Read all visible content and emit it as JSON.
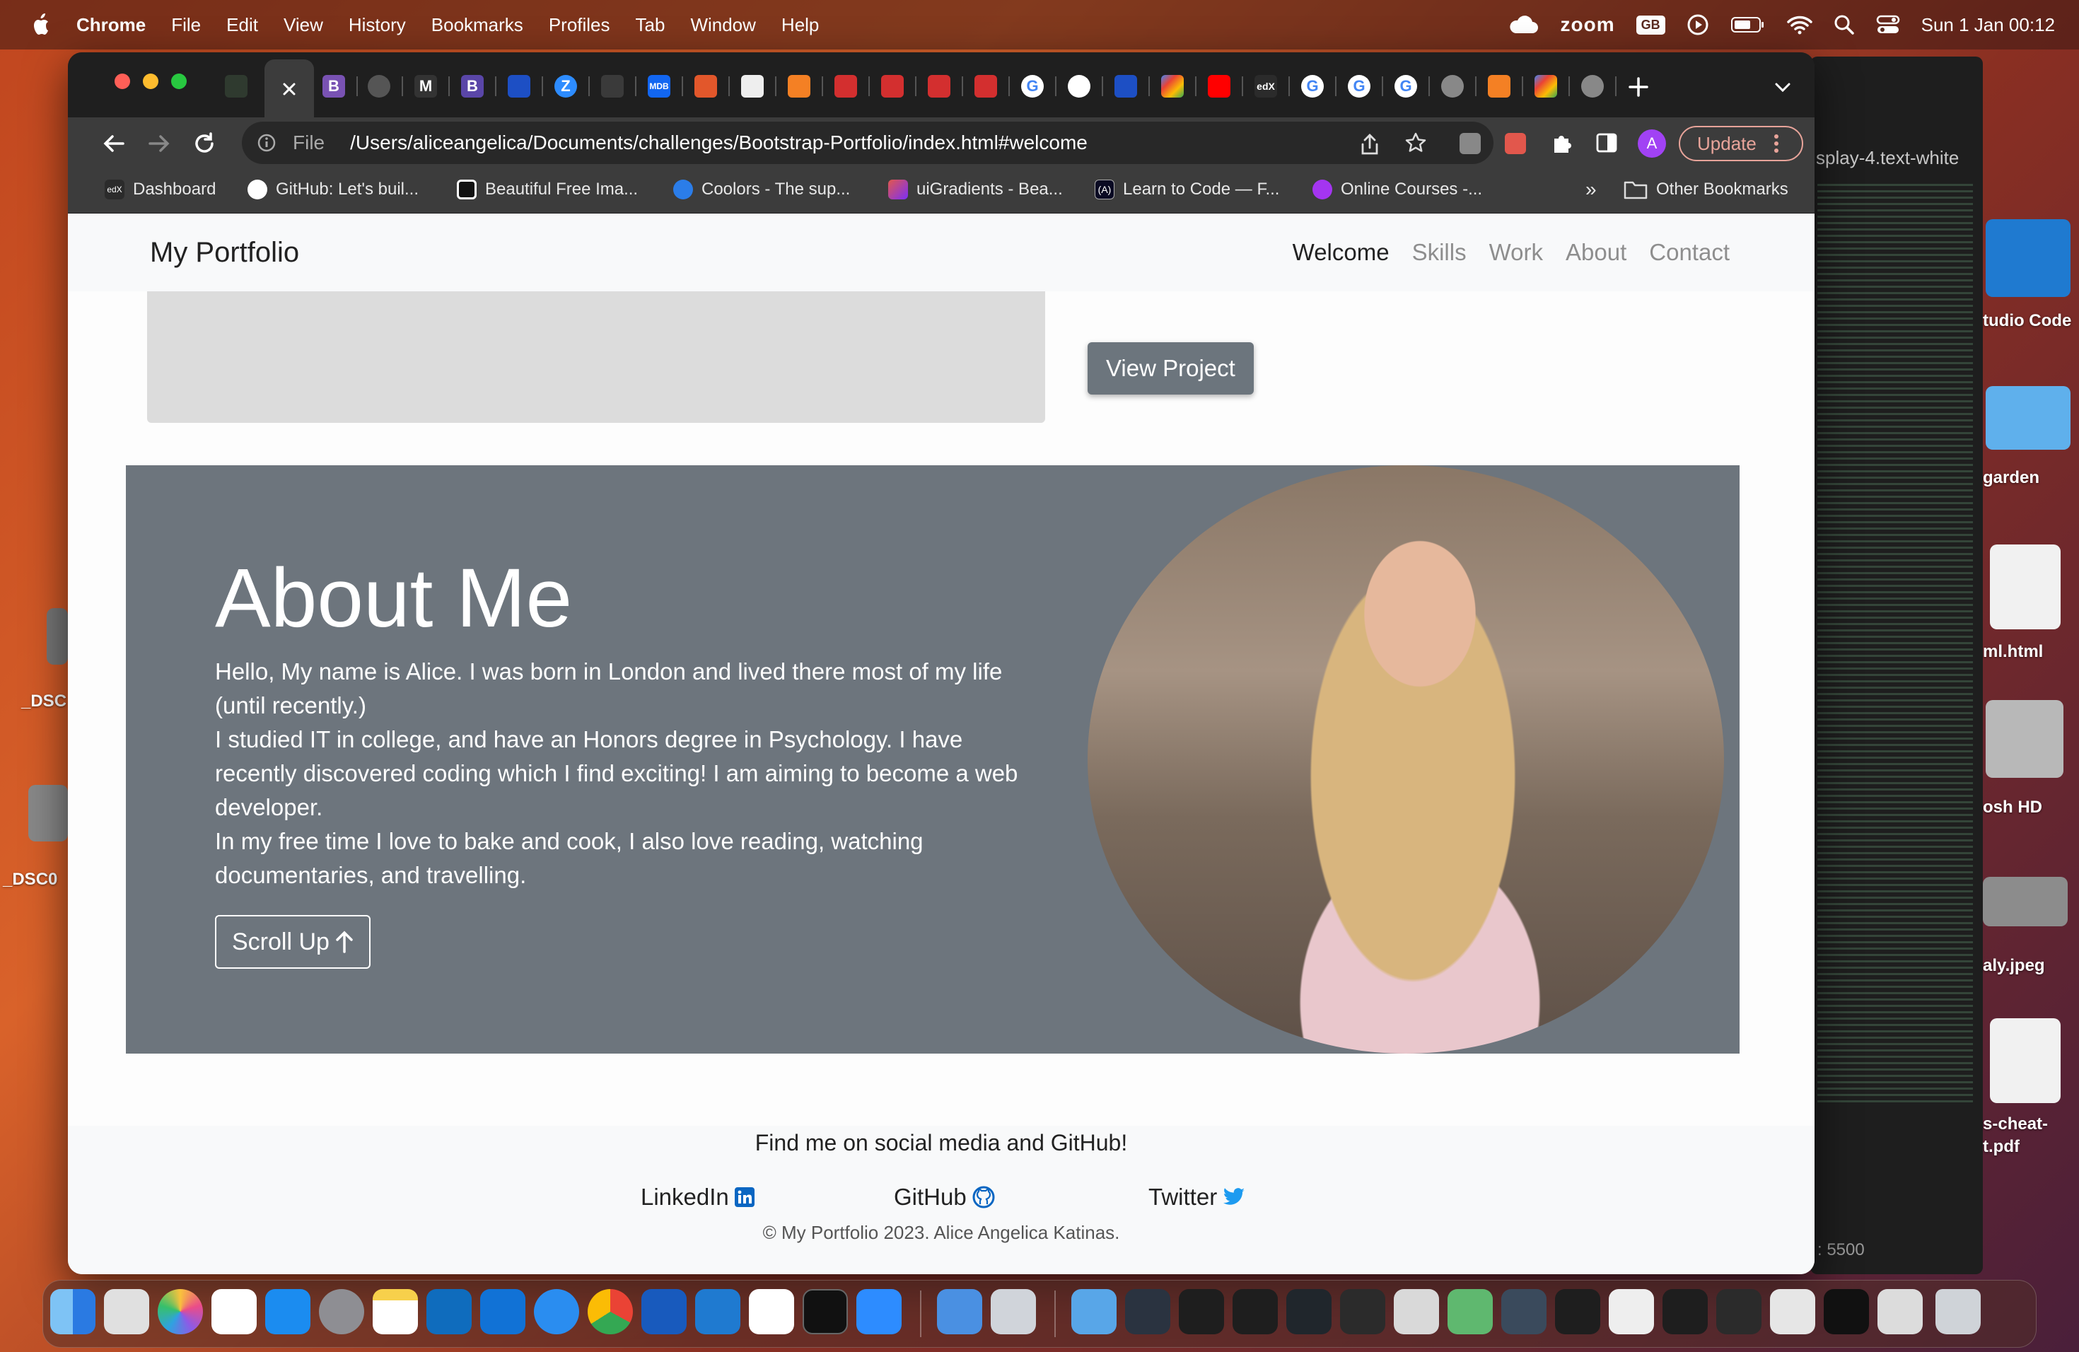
{
  "menubar": {
    "app_name": "Chrome",
    "items": [
      "File",
      "Edit",
      "View",
      "History",
      "Bookmarks",
      "Profiles",
      "Tab",
      "Window",
      "Help"
    ],
    "zoom_label": "zoom",
    "input_source": "GB",
    "datetime": "Sun 1 Jan  00:12"
  },
  "desktop": {
    "editor_breadcrumb": "splay-4.text-white",
    "editor_port": ": 5500",
    "right_labels": [
      "tudio Code",
      "garden",
      "ml.html",
      "osh HD",
      "aly.jpeg",
      "s-cheat-",
      "t.pdf"
    ],
    "left_labels": [
      "_DSC",
      "_DSC0"
    ]
  },
  "browser": {
    "address": {
      "scheme": "File",
      "path": "/Users/aliceangelica/Documents/challenges/Bootstrap-Portfolio/index.html#welcome"
    },
    "update_label": "Update",
    "profile_initial": "A",
    "bookmarks": [
      "Dashboard",
      "GitHub: Let's buil...",
      "Beautiful Free Ima...",
      "Coolors - The sup...",
      "uiGradients - Bea...",
      "Learn to Code — F...",
      "Online Courses -..."
    ],
    "other_bookmarks": "Other Bookmarks",
    "more_bookmarks": "»"
  },
  "site": {
    "brand": "My Portfolio",
    "nav": [
      "Welcome",
      "Skills",
      "Work",
      "About",
      "Contact"
    ],
    "active_nav": "Welcome",
    "view_project_label": "View Project",
    "about": {
      "title": "About Me",
      "paragraph_1": "Hello, My name is Alice. I was born in London and lived there most of my life (until recently.)",
      "paragraph_2": "I studied IT in college, and have an Honors degree in Psychology. I have recently discovered coding which I find exciting! I am aiming to become a web developer.",
      "paragraph_3": "In my free time I love to bake and cook, I also love reading, watching documentaries, and travelling.",
      "scroll_up_label": "Scroll Up"
    },
    "footer": {
      "heading": "Find me on social media and GitHub!",
      "links": [
        "LinkedIn",
        "GitHub",
        "Twitter"
      ],
      "copyright": "© My Portfolio 2023. Alice Angelica Katinas."
    }
  },
  "colors": {
    "about_bg": "#6d757d",
    "nav_bg": "#f8f9fa",
    "button_secondary": "#6c757d",
    "linkedin": "#0a66c2",
    "twitter": "#1d9bf0",
    "update_border": "#e8a49a"
  }
}
